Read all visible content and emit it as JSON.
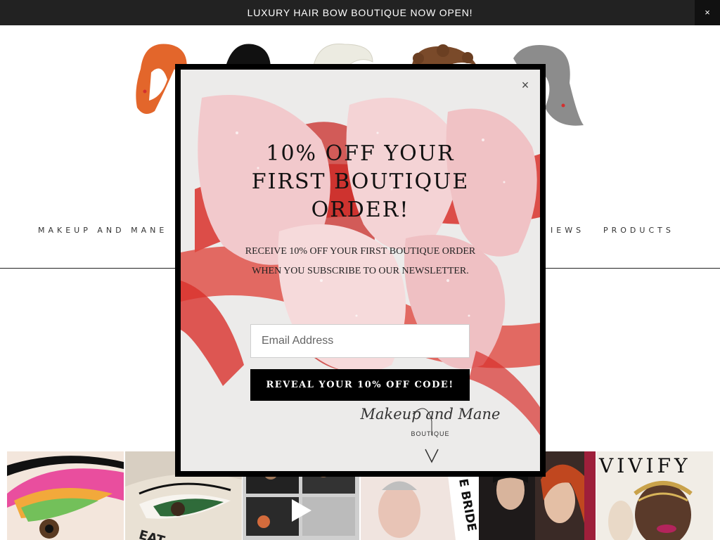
{
  "announcement": {
    "text": "LUXURY HAIR BOW BOUTIQUE NOW OPEN!",
    "close_label": "×"
  },
  "nav": {
    "left_item": "MAKEUP AND MANE",
    "right_item_partial": "IEWS",
    "products": "PRODUCTS"
  },
  "modal": {
    "close_label": "×",
    "title": "10% OFF YOUR FIRST BOUTIQUE ORDER!",
    "subtitle": "RECEIVE 10% OFF YOUR FIRST BOUTIQUE ORDER WHEN YOU SUBSCRIBE TO OUR NEWSLETTER.",
    "email_placeholder": "Email Address",
    "email_value": "",
    "button_label": "REVEAL YOUR 10% OFF CODE!",
    "brand_name": "Makeup and Mane",
    "brand_sub": "BOUTIQUE"
  },
  "instagram": {
    "thumbs": [
      {
        "caption": ""
      },
      {
        "caption": "EAT"
      },
      {
        "caption": ""
      },
      {
        "caption": "E BRIDE"
      },
      {
        "caption": ""
      },
      {
        "caption": "VIVIFY"
      }
    ]
  },
  "colors": {
    "bar": "#222222",
    "modal_border": "#000000",
    "button": "#000000",
    "bow_red": "#d9312c",
    "bow_pink": "#f2c9cc"
  }
}
